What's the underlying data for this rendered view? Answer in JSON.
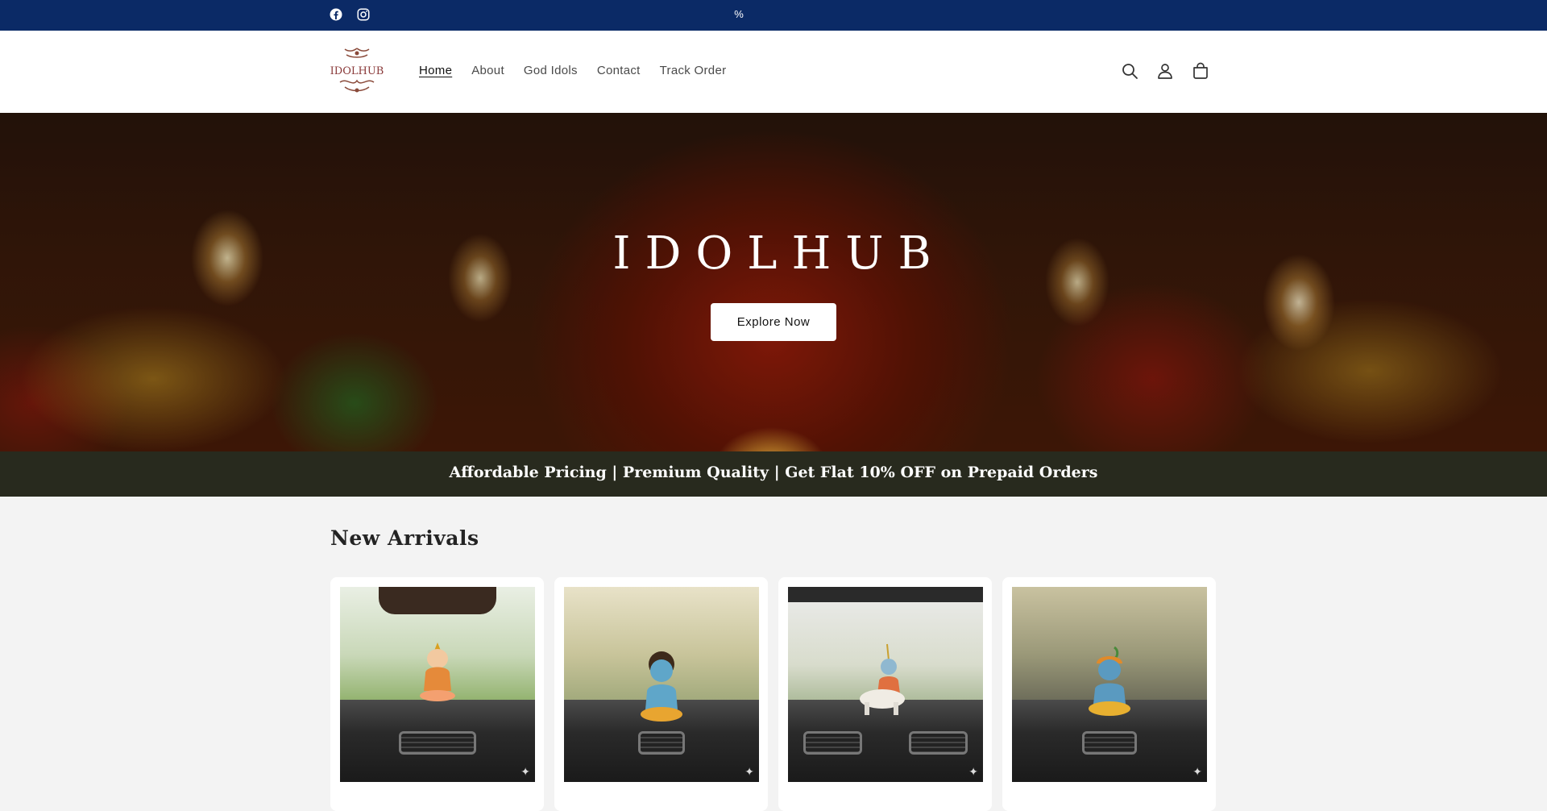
{
  "topbar": {
    "announcement": "%",
    "social": [
      "facebook-icon",
      "instagram-icon"
    ]
  },
  "header": {
    "logo_text": "IDOLHUB",
    "nav": [
      {
        "label": "Home",
        "active": true
      },
      {
        "label": "About",
        "active": false
      },
      {
        "label": "God Idols",
        "active": false
      },
      {
        "label": "Contact",
        "active": false
      },
      {
        "label": "Track Order",
        "active": false
      }
    ],
    "icons": [
      "search-icon",
      "account-icon",
      "cart-icon"
    ]
  },
  "hero": {
    "title": "IDOLHUB",
    "cta_label": "Explore Now"
  },
  "promo": {
    "text": "Affordable Pricing | Premium Quality | Get Flat 10% OFF on Prepaid Orders"
  },
  "section": {
    "title": "New Arrivals"
  },
  "colors": {
    "topbar": "#0b2a66",
    "promo": "#282a1e",
    "page_bg": "#f3f3f3"
  }
}
